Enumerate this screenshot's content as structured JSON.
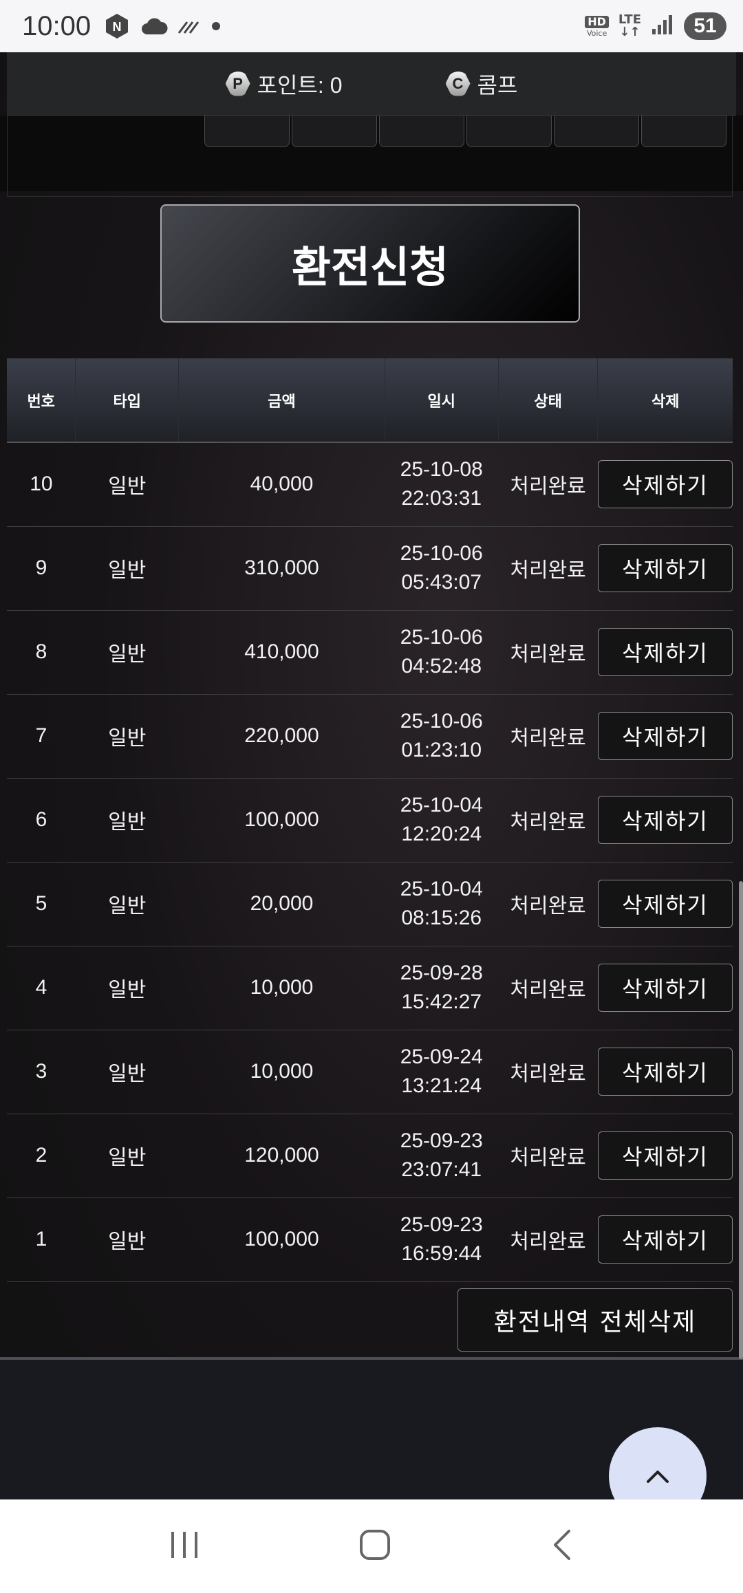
{
  "status_bar": {
    "time": "10:00",
    "battery": "51",
    "hd_label": "HD",
    "voice_label": "Voice",
    "lte_label": "LTE"
  },
  "header": {
    "points_label": "포인트: 0",
    "comp_label": "콤프",
    "points_icon": "P",
    "comp_icon": "C"
  },
  "submit_label": "환전신청",
  "table": {
    "headers": [
      "번호",
      "타입",
      "금액",
      "일시",
      "상태",
      "삭제"
    ],
    "rows": [
      {
        "no": "10",
        "type": "일반",
        "amount": "40,000",
        "date": "25-10-08",
        "time": "22:03:31",
        "status": "처리완료",
        "action": "삭제하기"
      },
      {
        "no": "9",
        "type": "일반",
        "amount": "310,000",
        "date": "25-10-06",
        "time": "05:43:07",
        "status": "처리완료",
        "action": "삭제하기"
      },
      {
        "no": "8",
        "type": "일반",
        "amount": "410,000",
        "date": "25-10-06",
        "time": "04:52:48",
        "status": "처리완료",
        "action": "삭제하기"
      },
      {
        "no": "7",
        "type": "일반",
        "amount": "220,000",
        "date": "25-10-06",
        "time": "01:23:10",
        "status": "처리완료",
        "action": "삭제하기"
      },
      {
        "no": "6",
        "type": "일반",
        "amount": "100,000",
        "date": "25-10-04",
        "time": "12:20:24",
        "status": "처리완료",
        "action": "삭제하기"
      },
      {
        "no": "5",
        "type": "일반",
        "amount": "20,000",
        "date": "25-10-04",
        "time": "08:15:26",
        "status": "처리완료",
        "action": "삭제하기"
      },
      {
        "no": "4",
        "type": "일반",
        "amount": "10,000",
        "date": "25-09-28",
        "time": "15:42:27",
        "status": "처리완료",
        "action": "삭제하기"
      },
      {
        "no": "3",
        "type": "일반",
        "amount": "10,000",
        "date": "25-09-24",
        "time": "13:21:24",
        "status": "처리완료",
        "action": "삭제하기"
      },
      {
        "no": "2",
        "type": "일반",
        "amount": "120,000",
        "date": "25-09-23",
        "time": "23:07:41",
        "status": "처리완료",
        "action": "삭제하기"
      },
      {
        "no": "1",
        "type": "일반",
        "amount": "100,000",
        "date": "25-09-23",
        "time": "16:59:44",
        "status": "처리완료",
        "action": "삭제하기"
      }
    ]
  },
  "clear_all_label": "환전내역 전체삭제",
  "icons": {
    "scroll_top": "chevron-up-icon",
    "nav_recents": "recents-icon",
    "nav_home": "home-icon",
    "nav_back": "back-icon"
  }
}
